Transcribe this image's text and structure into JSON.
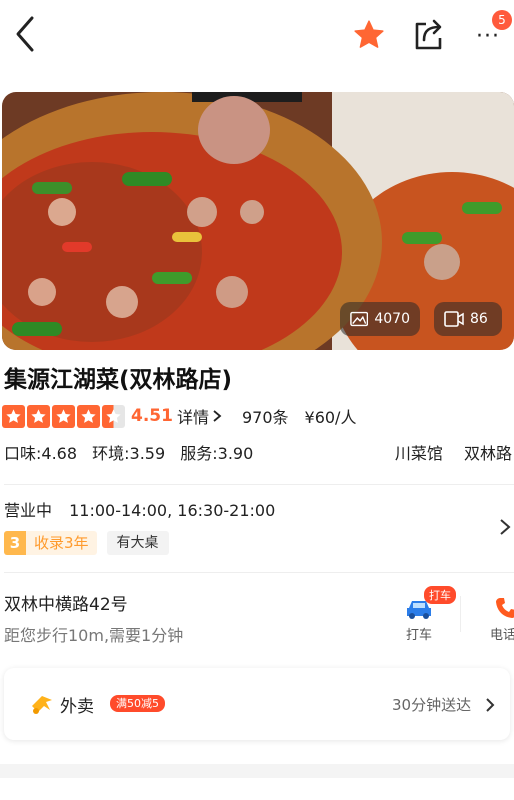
{
  "header": {
    "back_icon": "chevron-left-icon",
    "favorite_icon": "star-icon",
    "share_icon": "share-icon",
    "more_icon": "more-dots-icon",
    "more_dots": "···",
    "notification_count": "5",
    "accent_color": "#ff6633"
  },
  "hero": {
    "photo_count": "4070",
    "video_count": "86"
  },
  "shop": {
    "name": "集源江湖菜(双林路店)",
    "rating": 4.5,
    "score": "4.51",
    "detail_label": "详情",
    "review_count": "970条",
    "price": "¥60/人",
    "taste": "口味:4.68",
    "environment": "环境:3.59",
    "service": "服务:3.90",
    "category": "川菜馆",
    "area": "双林路"
  },
  "hours": {
    "status": "营业中",
    "time": "11:00-14:00, 16:30-21:00",
    "year_num": "3",
    "year_text": "收录3年",
    "feature_tag": "有大桌"
  },
  "location": {
    "address": "双林中横路42号",
    "distance": "距您步行10m,需要1分钟",
    "taxi_badge": "打车",
    "taxi_label": "打车",
    "phone_label": "电话"
  },
  "delivery": {
    "label": "外卖",
    "promo": "满50减5",
    "time": "30分钟送达"
  }
}
